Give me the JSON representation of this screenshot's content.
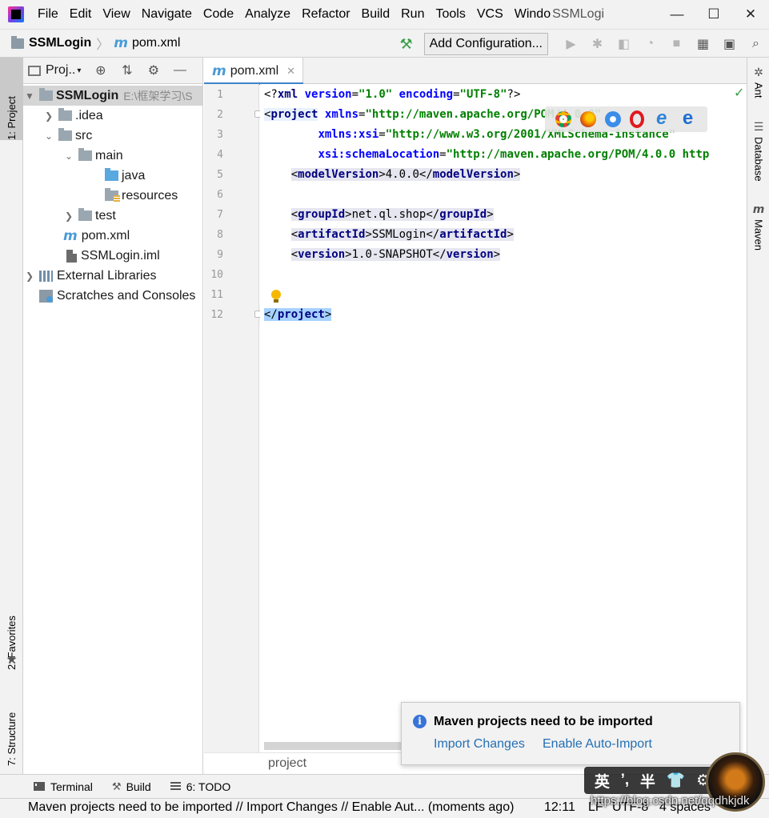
{
  "menubar": {
    "items": [
      "File",
      "Edit",
      "View",
      "Navigate",
      "Code",
      "Analyze",
      "Refactor",
      "Build",
      "Run",
      "Tools",
      "VCS",
      "Windo"
    ],
    "window_title": "SSMLogi",
    "minimize": "—",
    "maximize": "☐",
    "close": "✕"
  },
  "navbar": {
    "project": "SSMLogin",
    "file": "pom.xml",
    "add_configuration": "Add Configuration..."
  },
  "left_stripe": {
    "project_tab": "1: Project",
    "favorites_tab": "2: Favorites",
    "structure_tab": "7: Structure"
  },
  "right_stripe": {
    "ant_tab": "Ant",
    "database_tab": "Database",
    "maven_tab": "Maven"
  },
  "project_panel": {
    "title": "Proj..",
    "tree": [
      {
        "label": "SSMLogin",
        "path": "E:\\框架学习\\S"
      },
      {
        "label": ".idea"
      },
      {
        "label": "src"
      },
      {
        "label": "main"
      },
      {
        "label": "java"
      },
      {
        "label": "resources"
      },
      {
        "label": "test"
      },
      {
        "label": "pom.xml"
      },
      {
        "label": "SSMLogin.iml"
      },
      {
        "label": "External Libraries"
      },
      {
        "label": "Scratches and Consoles"
      }
    ]
  },
  "editor": {
    "tab_label": "pom.xml",
    "line_numbers": [
      "1",
      "2",
      "3",
      "4",
      "5",
      "6",
      "7",
      "8",
      "9",
      "10",
      "11",
      "12"
    ],
    "code": {
      "l1_open": "<?",
      "l1_xml": "xml",
      "l1_version_attr": "version",
      "l1_version_val": "\"1.0\"",
      "l1_encoding_attr": "encoding",
      "l1_encoding_val": "\"UTF-8\"",
      "l1_close": "?>",
      "l2_tag": "project",
      "l2_attr": "xmlns",
      "l2_val": "\"http://maven.apache.org/POM/4.0.0\"",
      "l3_attr": "xmlns:xsi",
      "l3_val": "\"http://www.w3.org/2001/XMLSchema-instance\"",
      "l4_attr": "xsi:schemaLocation",
      "l4_val": "\"http://maven.apache.org/POM/4.0.0 http",
      "l5_tag": "modelVersion",
      "l5_val": "4.0.0",
      "l7_tag": "groupId",
      "l7_val": "net.ql.shop",
      "l8_tag": "artifactId",
      "l8_val": "SSMLogin",
      "l9_tag": "version",
      "l9_val": "1.0-SNAPSHOT",
      "l12_tag": "project"
    },
    "breadcrumb": "project"
  },
  "notification": {
    "title": "Maven projects need to be imported",
    "import_changes": "Import Changes",
    "enable_auto_import": "Enable Auto-Import"
  },
  "bottom_tools": {
    "terminal": "Terminal",
    "build": "Build",
    "todo": "6: TODO"
  },
  "statusbar": {
    "message": "Maven projects need to be imported // Import Changes // Enable Aut... (moments ago)",
    "position": "12:11",
    "line_sep": "LF",
    "encoding": "UTF-8",
    "indent": "4 spaces"
  },
  "watermark": {
    "ime": [
      "英",
      "’,",
      "半",
      "👕",
      "⚙"
    ],
    "url": "https://blog.csdn.net/qqdhkjdk"
  },
  "colors": {
    "tag": "#000080",
    "attr": "#0000ff",
    "string": "#008000",
    "link": "#2470b3",
    "selection": "#a6d2ff"
  }
}
